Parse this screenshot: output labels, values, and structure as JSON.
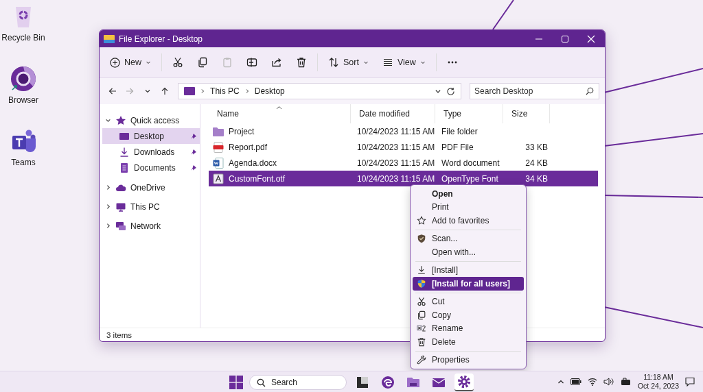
{
  "desktop_icons": [
    {
      "label": "Recycle Bin",
      "kind": "bin"
    },
    {
      "label": "Browser",
      "kind": "browser"
    },
    {
      "label": "Teams",
      "kind": "teams"
    }
  ],
  "window": {
    "title": "File Explorer - Desktop"
  },
  "toolbar": [
    {
      "kind": "new",
      "label": "New",
      "disabled": false
    },
    {
      "kind": "cut",
      "disabled": false
    },
    {
      "kind": "copy",
      "disabled": false
    },
    {
      "kind": "paste",
      "disabled": true
    },
    {
      "kind": "rename",
      "disabled": false
    },
    {
      "kind": "share",
      "disabled": false
    },
    {
      "kind": "delete",
      "disabled": false
    },
    {
      "kind": "sort",
      "label": "Sort",
      "disabled": false
    },
    {
      "kind": "view",
      "label": "View",
      "disabled": false
    },
    {
      "kind": "more",
      "disabled": false
    }
  ],
  "nav_buttons": [
    {
      "kind": "back",
      "disabled": false
    },
    {
      "kind": "forward",
      "disabled": true
    },
    {
      "kind": "recent",
      "disabled": false
    },
    {
      "kind": "up",
      "disabled": false
    }
  ],
  "breadcrumb": [
    "This PC",
    "Desktop"
  ],
  "search": {
    "placeholder": "Search Desktop"
  },
  "sidebar": {
    "items": [
      {
        "label": "Quick access",
        "kind": "star",
        "expanded": true,
        "selected": false,
        "children": [
          {
            "label": "Desktop",
            "kind": "desktop",
            "selected": true,
            "pinned": true
          },
          {
            "label": "Downloads",
            "kind": "download",
            "selected": false,
            "pinned": true
          },
          {
            "label": "Documents",
            "kind": "document",
            "selected": false,
            "pinned": true
          }
        ]
      },
      {
        "label": "OneDrive",
        "kind": "cloud",
        "expanded": false,
        "selected": false
      },
      {
        "label": "This PC",
        "kind": "pc",
        "expanded": false,
        "selected": false
      },
      {
        "label": "Network",
        "kind": "network",
        "expanded": false,
        "selected": false
      }
    ]
  },
  "table": {
    "columns": [
      {
        "label": "Name",
        "sorted": true
      },
      {
        "label": "Date modified",
        "sorted": false
      },
      {
        "label": "Type",
        "sorted": false
      },
      {
        "label": "Size",
        "sorted": false
      }
    ],
    "rows": [
      {
        "name": "Project",
        "date": "10/24/2023 11:15 AM",
        "type": "File folder",
        "kind": "folder",
        "selected": false
      },
      {
        "name": "Report.pdf",
        "date": "10/24/2023 11:15 AM",
        "type": "PDF File",
        "size": "33 KB",
        "kind": "pdf",
        "selected": false
      },
      {
        "name": "Agenda.docx",
        "date": "10/24/2023 11:15 AM",
        "type": "Word document",
        "size": "24 KB",
        "kind": "word",
        "selected": false
      },
      {
        "name": "CustomFont.otf",
        "date": "10/24/2023 11:15 AM",
        "type": "OpenType Font",
        "size": "34 KB",
        "kind": "font",
        "selected": true
      }
    ]
  },
  "status_bar": "3 items",
  "context_menu": [
    {
      "kind": "open",
      "label": "Open",
      "bold": true,
      "selected": false
    },
    {
      "kind": "print",
      "label": "Print",
      "bold": false,
      "selected": false
    },
    {
      "kind": "favorite",
      "label": "Add to favorites",
      "bold": false,
      "selected": false
    },
    {
      "kind": "separator"
    },
    {
      "kind": "scan",
      "label": "Scan...",
      "bold": false,
      "selected": false
    },
    {
      "kind": "open_with",
      "label": "Open with...",
      "bold": false,
      "selected": false
    },
    {
      "kind": "separator"
    },
    {
      "kind": "install",
      "label": "[Install]",
      "bold": false,
      "selected": false
    },
    {
      "kind": "install_all",
      "label": "[Install for all users]",
      "bold": true,
      "selected": true
    },
    {
      "kind": "separator"
    },
    {
      "kind": "cut",
      "label": "Cut",
      "bold": false,
      "selected": false
    },
    {
      "kind": "copy",
      "label": "Copy",
      "bold": false,
      "selected": false
    },
    {
      "kind": "rename",
      "label": "Rename",
      "bold": false,
      "selected": false
    },
    {
      "kind": "delete",
      "label": "Delete",
      "bold": false,
      "selected": false
    },
    {
      "kind": "separator"
    },
    {
      "kind": "properties",
      "label": "Properties",
      "bold": false,
      "selected": false
    }
  ],
  "taskbar": {
    "search": "Search",
    "apps": [
      {
        "kind": "files",
        "selected": false
      },
      {
        "kind": "edge",
        "selected": false
      },
      {
        "kind": "folder",
        "selected": false
      },
      {
        "kind": "mail",
        "selected": false
      },
      {
        "kind": "settings",
        "selected": true
      }
    ],
    "time": "11:18 AM",
    "date": "Oct 24, 2023"
  }
}
